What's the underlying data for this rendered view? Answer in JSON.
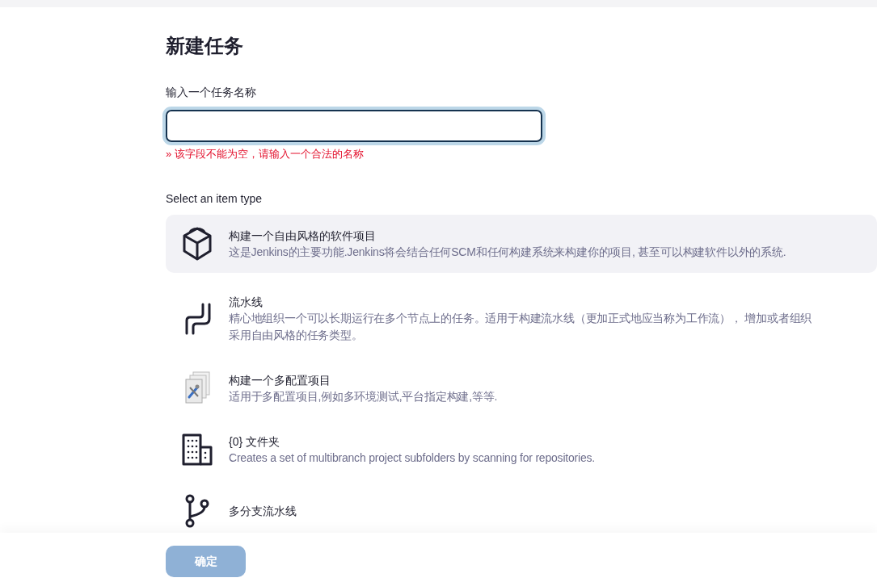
{
  "title": "新建任务",
  "name_field": {
    "label": "输入一个任务名称",
    "focused": true,
    "error": "» 该字段不能为空，请输入一个合法的名称"
  },
  "item_type_heading": "Select an item type",
  "item_types": [
    {
      "kind": "cube",
      "selected": true,
      "name": "构建一个自由风格的软件项目",
      "description": [
        "这是Jenkins的主要功能.Jenkins将会结合任何SCM和任何构建系统来构建你的项目, 甚至可以构建软件以外的系统."
      ]
    },
    {
      "kind": "pipeline",
      "selected": false,
      "name": "流水线",
      "description": [
        "精心地组织一个可以长期运行在多个节点上的任务。适用于构建流水线（更加正式地应当称为工作流）， 增加或者组织",
        "采用自由风格的任务类型。"
      ]
    },
    {
      "kind": "matrix",
      "selected": false,
      "name": "构建一个多配置项目",
      "description": [
        "适用于多配置项目,例如多环境测试,平台指定构建,等等."
      ]
    },
    {
      "kind": "folder",
      "selected": false,
      "name": "{0} 文件夹",
      "description": [
        "Creates a set of multibranch project subfolders by scanning for repositories."
      ]
    },
    {
      "kind": "branch",
      "selected": false,
      "name": "多分支流水线"
    }
  ],
  "ok_button": {
    "label": "确定",
    "disabled": true
  }
}
